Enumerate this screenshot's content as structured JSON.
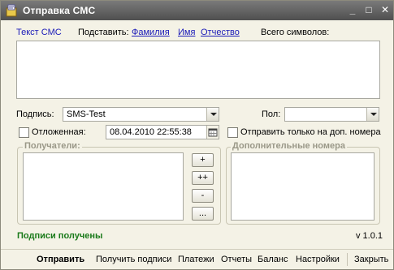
{
  "window": {
    "title": "Отправка СМС",
    "minimize_glyph": "_",
    "maximize_glyph": "□",
    "close_glyph": "✕"
  },
  "message": {
    "label": "Текст СМС",
    "substitute_label": "Подставить:",
    "substitute_links": [
      "Фамилия",
      "Имя",
      "Отчество"
    ],
    "char_count_label": "Всего символов:",
    "text": ""
  },
  "signature": {
    "label": "Подпись:",
    "value": "SMS-Test"
  },
  "gender": {
    "label": "Пол:",
    "value": ""
  },
  "delayed": {
    "label": "Отложенная:",
    "checked": false,
    "datetime": "08.04.2010 22:55:38"
  },
  "extra_only": {
    "label": "Отправить только на доп. номера",
    "checked": false
  },
  "recipients": {
    "title": "Получатели:",
    "buttons": [
      "+",
      "++",
      "-",
      "..."
    ]
  },
  "extra_numbers": {
    "title": "Дополнительные номера"
  },
  "status": {
    "text": "Подписи получены",
    "version": "v 1.0.1",
    "status_color": "#1a7a1a"
  },
  "bottom_buttons": [
    "Отправить",
    "Получить подписи",
    "Платежи",
    "Отчеты",
    "Баланс",
    "Настройки",
    "Закрыть"
  ],
  "icons": [
    "app-icon",
    "calendar-icon",
    "chevron-down-icon"
  ]
}
